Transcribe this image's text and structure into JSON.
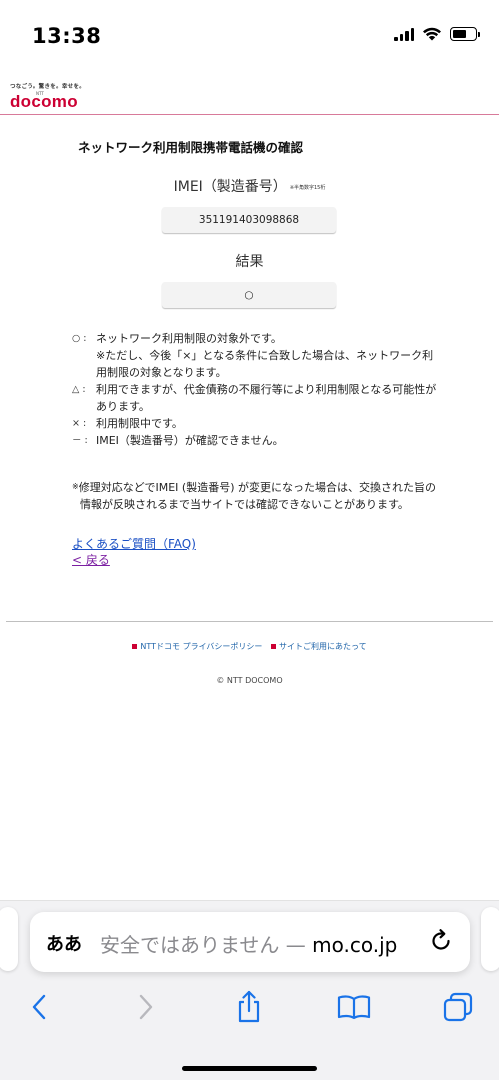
{
  "status_bar": {
    "time": "13:38",
    "battery_level": 0.6,
    "icons": [
      "cellular-signal-icon",
      "wifi-icon",
      "battery-icon"
    ]
  },
  "brand": {
    "tagline": "つなごう。驚きを。幸せを。",
    "ntt": "NTT",
    "logo": "docomo",
    "accent_color": "#cc0033"
  },
  "page": {
    "title": "ネットワーク利用制限携帯電話機の確認",
    "imei_label": "IMEI（製造番号）",
    "imei_note": "※半角数字15桁",
    "imei_value": "351191403098868",
    "result_label": "結果",
    "result_value": "○"
  },
  "legend": [
    {
      "symbol": "○ :",
      "text": "ネットワーク利用制限の対象外です。",
      "sub": "※ただし、今後「×」となる条件に合致した場合は、ネットワーク利用制限の対象となります。"
    },
    {
      "symbol": "△ :",
      "text": "利用できますが、代金債務の不履行等により利用制限となる可能性があります。"
    },
    {
      "symbol": "× :",
      "text": "利用制限中です。"
    },
    {
      "symbol": "－ :",
      "text": "IMEI（製造番号）が確認できません。"
    }
  ],
  "notice": {
    "mark": "※",
    "text": "修理対応などでIMEI (製造番号) が変更になった場合は、交換された旨の情報が反映されるまで当サイトでは確認できないことがあります。"
  },
  "links": {
    "faq": "よくあるご質問（FAQ)",
    "back": "< 戻る"
  },
  "footer": {
    "links": [
      "NTTドコモ プライバシーポリシー",
      "サイトご利用にあたって"
    ],
    "copyright": "© NTT DOCOMO"
  },
  "browser": {
    "aa_label": "ああ",
    "address_prefix": "安全ではありません — ",
    "address_domain": "mo.co.jp",
    "toolbar_icons": [
      "back-icon",
      "forward-icon",
      "share-icon",
      "bookmarks-icon",
      "tabs-icon"
    ]
  }
}
